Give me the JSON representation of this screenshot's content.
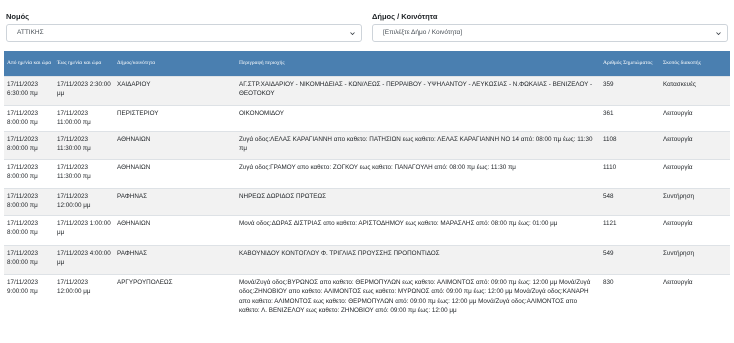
{
  "filters": {
    "prefecture": {
      "label": "Νομός",
      "value": "ΑΤΤΙΚΗΣ"
    },
    "municipality": {
      "label": "Δήμος / Κοινότητα",
      "value": "[Επιλέξτε Δήμο / Κοινότητα]"
    }
  },
  "table": {
    "headers": [
      "Από ημ/νία και ώρα",
      "Έως ημ/νία και ώρα",
      "Δήμος/κοινότητα",
      "Περιγραφή περιοχής",
      "Αριθμός Σημειώματος",
      "Σκοπός διακοπής"
    ],
    "rows": [
      [
        "17/11/2023 6:30:00 πμ",
        "17/11/2023 2:30:00 μμ",
        "ΧΑΙΔΑΡΙΟΥ",
        "ΑΓ.ΣΤΡ.ΧΑΙΔΑΡΙΟΥ - ΝΙΚΟΜΗΔΕΙΑΣ - ΚΩΝ/ΛΕΩΣ - ΠΕΡΡΑΙΒΟΥ - ΥΨΗΛΑΝΤΟΥ - ΛΕΥΚΩΣΙΑΣ - Ν.ΦΩΚΑΙΑΣ - ΒΕΝΙΖΕΛΟΥ - ΘΕΟΤΟΚΟΥ",
        "359",
        "Κατασκευές"
      ],
      [
        "17/11/2023 8:00:00 πμ",
        "17/11/2023 11:00:00 πμ",
        "ΠΕΡΙΣΤΕΡΙΟΥ",
        "ΟΙΚΟΝΟΜΙΔΟΥ",
        "361",
        "Λειτουργία"
      ],
      [
        "17/11/2023 8:00:00 πμ",
        "17/11/2023 11:30:00 πμ",
        "ΑΘΗΝΑΙΩΝ",
        "Ζυγά οδος:ΛΕΛΑΣ ΚΑΡΑΓΙΑΝΝΗ απο καθετο: ΠΑΤΗΣΙΩΝ εως καθετο: ΛΕΛΑΣ ΚΑΡΑΓΙΑΝΝΗ ΝΟ 14 από: 08:00 πμ έως: 11:30 πμ",
        "1108",
        "Λειτουργία"
      ],
      [
        "17/11/2023 8:00:00 πμ",
        "17/11/2023 11:30:00 πμ",
        "ΑΘΗΝΑΙΩΝ",
        "Ζυγά οδος:ΓΡΑΜΟΥ απο καθετο: ΖΟΓΚΟΥ εως καθετο: ΠΑΝΑΓΟΥΛΗ από: 08:00 πμ έως: 11:30 πμ",
        "1110",
        "Λειτουργία"
      ],
      [
        "17/11/2023 8:00:00 πμ",
        "17/11/2023 12:00:00 μμ",
        "ΡΑΦΗΝΑΣ",
        "ΝΗΡΕΩΣ ΔΩΡΙΔΟΣ ΠΡΩΤΕΩΣ",
        "548",
        "Συντήρηση"
      ],
      [
        "17/11/2023 8:00:00 πμ",
        "17/11/2023 1:00:00 μμ",
        "ΑΘΗΝΑΙΩΝ",
        "Μονά οδος:ΔΩΡΑΣ ΔΙΣΤΡΙΑΣ απο καθετο: ΑΡΙΣΤΟΔΗΜΟΥ εως καθετο: ΜΑΡΑΣΛΗΣ από: 08:00 πμ έως: 01:00 μμ",
        "1121",
        "Λειτουργία"
      ],
      [
        "17/11/2023 8:00:00 πμ",
        "17/11/2023 4:00:00 μμ",
        "ΡΑΦΗΝΑΣ",
        "ΚΑΒΟΥΝΙΔΟΥ ΚΟΝΤΟΓΛΟΥ Φ. ΤΡΙΓΛΙΑΣ ΠΡΟΥΣΣΗΣ ΠΡΟΠΟΝΤΙΔΟΣ",
        "549",
        "Συντήρηση"
      ],
      [
        "17/11/2023 9:00:00 πμ",
        "17/11/2023 12:00:00 μμ",
        "ΑΡΓΥΡΟΥΠΟΛΕΩΣ",
        "Μονά/Ζυγά οδος:ΒΥΡΩΝΟΣ απο καθετο: ΘΕΡΜΟΠΥΛΩΝ εως καθετο: ΑΛΙΜΟΝΤΟΣ από: 09:00 πμ έως: 12:00 μμ Μονά/Ζυγά οδος:ΖΗΝΟΒΙΟΥ απο καθετο: ΑΛΙΜΟΝΤΟΣ εως καθετο: ΜΥΡΩΝΟΣ από: 09:00 πμ έως: 12:00 μμ Μονά/Ζυγά οδος:ΚΑΝΑΡΗ απο καθετο: ΑΛΙΜΟΝΤΟΣ εως καθετο: ΘΕΡΜΟΠΥΛΩΝ από: 09:00 πμ έως: 12:00 μμ Μονά/Ζυγά οδος:ΑΛΙΜΟΝΤΟΣ απο καθετο: Λ. ΒΕΝΙΖΕΛΟΥ εως καθετο: ΖΗΝΟΒΙΟΥ από: 09:00 πμ έως: 12:00 μμ",
        "830",
        "Λειτουργία"
      ]
    ]
  },
  "icons": {
    "dropdown": "chevron-down-icon"
  }
}
